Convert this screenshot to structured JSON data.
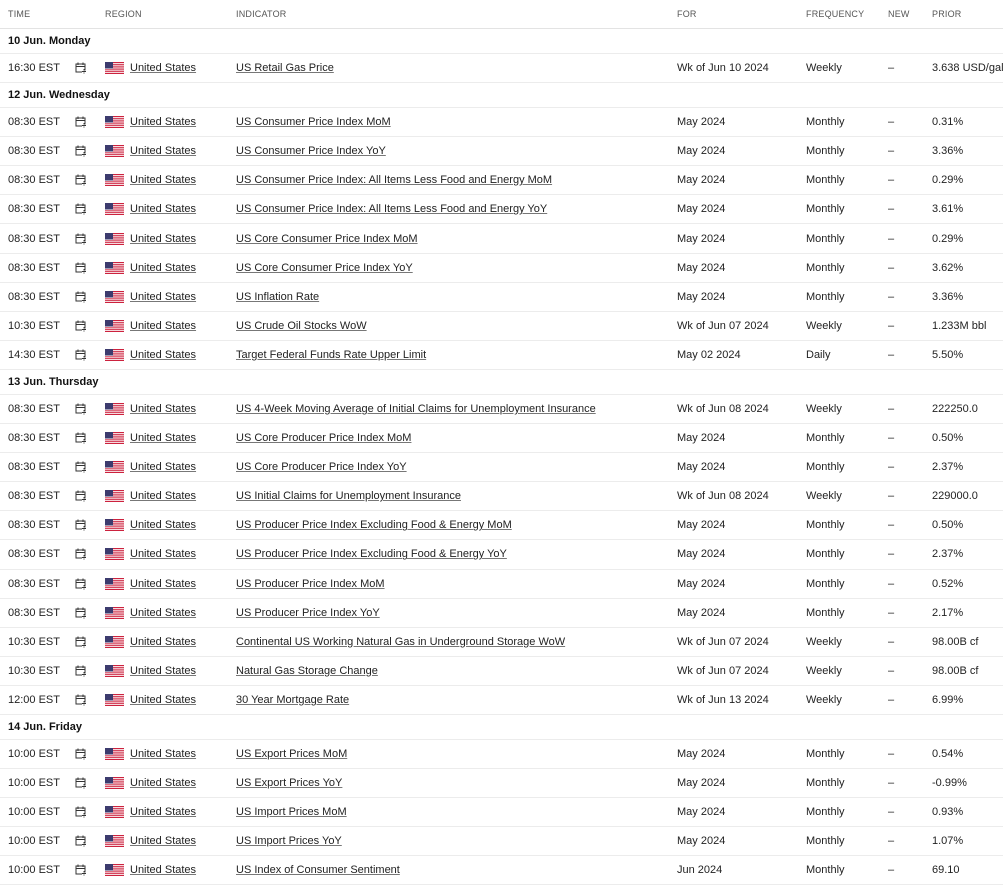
{
  "headers": {
    "time": "TIME",
    "region": "REGION",
    "indicator": "INDICATOR",
    "for": "FOR",
    "frequency": "FREQUENCY",
    "new": "NEW",
    "prior": "PRIOR"
  },
  "icons": {
    "calendar": "calendar-add-icon",
    "flag": "us-flag-icon"
  },
  "colors": {
    "flag_red": "#c8102e",
    "flag_blue": "#3c3b6e"
  },
  "groups": [
    {
      "date": "10 Jun. Monday",
      "rows": [
        {
          "time": "16:30 EST",
          "region": "United States",
          "indicator": "US Retail Gas Price",
          "for": "Wk of Jun 10 2024",
          "frequency": "Weekly",
          "new": "–",
          "prior": "3.638 USD/gal"
        }
      ]
    },
    {
      "date": "12 Jun. Wednesday",
      "rows": [
        {
          "time": "08:30 EST",
          "region": "United States",
          "indicator": "US Consumer Price Index MoM",
          "for": "May 2024",
          "frequency": "Monthly",
          "new": "–",
          "prior": "0.31%"
        },
        {
          "time": "08:30 EST",
          "region": "United States",
          "indicator": "US Consumer Price Index YoY",
          "for": "May 2024",
          "frequency": "Monthly",
          "new": "–",
          "prior": "3.36%"
        },
        {
          "time": "08:30 EST",
          "region": "United States",
          "indicator": "US Consumer Price Index: All Items Less Food and Energy MoM",
          "for": "May 2024",
          "frequency": "Monthly",
          "new": "–",
          "prior": "0.29%"
        },
        {
          "time": "08:30 EST",
          "region": "United States",
          "indicator": "US Consumer Price Index: All Items Less Food and Energy YoY",
          "for": "May 2024",
          "frequency": "Monthly",
          "new": "–",
          "prior": "3.61%"
        },
        {
          "time": "08:30 EST",
          "region": "United States",
          "indicator": "US Core Consumer Price Index MoM",
          "for": "May 2024",
          "frequency": "Monthly",
          "new": "–",
          "prior": "0.29%"
        },
        {
          "time": "08:30 EST",
          "region": "United States",
          "indicator": "US Core Consumer Price Index YoY",
          "for": "May 2024",
          "frequency": "Monthly",
          "new": "–",
          "prior": "3.62%"
        },
        {
          "time": "08:30 EST",
          "region": "United States",
          "indicator": "US Inflation Rate",
          "for": "May 2024",
          "frequency": "Monthly",
          "new": "–",
          "prior": "3.36%"
        },
        {
          "time": "10:30 EST",
          "region": "United States",
          "indicator": "US Crude Oil Stocks WoW",
          "for": "Wk of Jun 07 2024",
          "frequency": "Weekly",
          "new": "–",
          "prior": "1.233M bbl"
        },
        {
          "time": "14:30 EST",
          "region": "United States",
          "indicator": "Target Federal Funds Rate Upper Limit",
          "for": "May 02 2024",
          "frequency": "Daily",
          "new": "–",
          "prior": "5.50%"
        }
      ]
    },
    {
      "date": "13 Jun. Thursday",
      "rows": [
        {
          "time": "08:30 EST",
          "region": "United States",
          "indicator": "US 4-Week Moving Average of Initial Claims for Unemployment Insurance",
          "for": "Wk of Jun 08 2024",
          "frequency": "Weekly",
          "new": "–",
          "prior": "222250.0"
        },
        {
          "time": "08:30 EST",
          "region": "United States",
          "indicator": "US Core Producer Price Index MoM",
          "for": "May 2024",
          "frequency": "Monthly",
          "new": "–",
          "prior": "0.50%"
        },
        {
          "time": "08:30 EST",
          "region": "United States",
          "indicator": "US Core Producer Price Index YoY",
          "for": "May 2024",
          "frequency": "Monthly",
          "new": "–",
          "prior": "2.37%"
        },
        {
          "time": "08:30 EST",
          "region": "United States",
          "indicator": "US Initial Claims for Unemployment Insurance",
          "for": "Wk of Jun 08 2024",
          "frequency": "Weekly",
          "new": "–",
          "prior": "229000.0"
        },
        {
          "time": "08:30 EST",
          "region": "United States",
          "indicator": "US Producer Price Index Excluding Food & Energy MoM",
          "for": "May 2024",
          "frequency": "Monthly",
          "new": "–",
          "prior": "0.50%"
        },
        {
          "time": "08:30 EST",
          "region": "United States",
          "indicator": "US Producer Price Index Excluding Food & Energy YoY",
          "for": "May 2024",
          "frequency": "Monthly",
          "new": "–",
          "prior": "2.37%"
        },
        {
          "time": "08:30 EST",
          "region": "United States",
          "indicator": "US Producer Price Index MoM",
          "for": "May 2024",
          "frequency": "Monthly",
          "new": "–",
          "prior": "0.52%"
        },
        {
          "time": "08:30 EST",
          "region": "United States",
          "indicator": "US Producer Price Index YoY",
          "for": "May 2024",
          "frequency": "Monthly",
          "new": "–",
          "prior": "2.17%"
        },
        {
          "time": "10:30 EST",
          "region": "United States",
          "indicator": "Continental US Working Natural Gas in Underground Storage WoW",
          "for": "Wk of Jun 07 2024",
          "frequency": "Weekly",
          "new": "–",
          "prior": "98.00B cf"
        },
        {
          "time": "10:30 EST",
          "region": "United States",
          "indicator": "Natural Gas Storage Change",
          "for": "Wk of Jun 07 2024",
          "frequency": "Weekly",
          "new": "–",
          "prior": "98.00B cf"
        },
        {
          "time": "12:00 EST",
          "region": "United States",
          "indicator": "30 Year Mortgage Rate",
          "for": "Wk of Jun 13 2024",
          "frequency": "Weekly",
          "new": "–",
          "prior": "6.99%"
        }
      ]
    },
    {
      "date": "14 Jun. Friday",
      "rows": [
        {
          "time": "10:00 EST",
          "region": "United States",
          "indicator": "US Export Prices MoM",
          "for": "May 2024",
          "frequency": "Monthly",
          "new": "–",
          "prior": "0.54%"
        },
        {
          "time": "10:00 EST",
          "region": "United States",
          "indicator": "US Export Prices YoY",
          "for": "May 2024",
          "frequency": "Monthly",
          "new": "–",
          "prior": "-0.99%"
        },
        {
          "time": "10:00 EST",
          "region": "United States",
          "indicator": "US Import Prices MoM",
          "for": "May 2024",
          "frequency": "Monthly",
          "new": "–",
          "prior": "0.93%"
        },
        {
          "time": "10:00 EST",
          "region": "United States",
          "indicator": "US Import Prices YoY",
          "for": "May 2024",
          "frequency": "Monthly",
          "new": "–",
          "prior": "1.07%"
        },
        {
          "time": "10:00 EST",
          "region": "United States",
          "indicator": "US Index of Consumer Sentiment",
          "for": "Jun 2024",
          "frequency": "Monthly",
          "new": "–",
          "prior": "69.10"
        }
      ]
    }
  ]
}
